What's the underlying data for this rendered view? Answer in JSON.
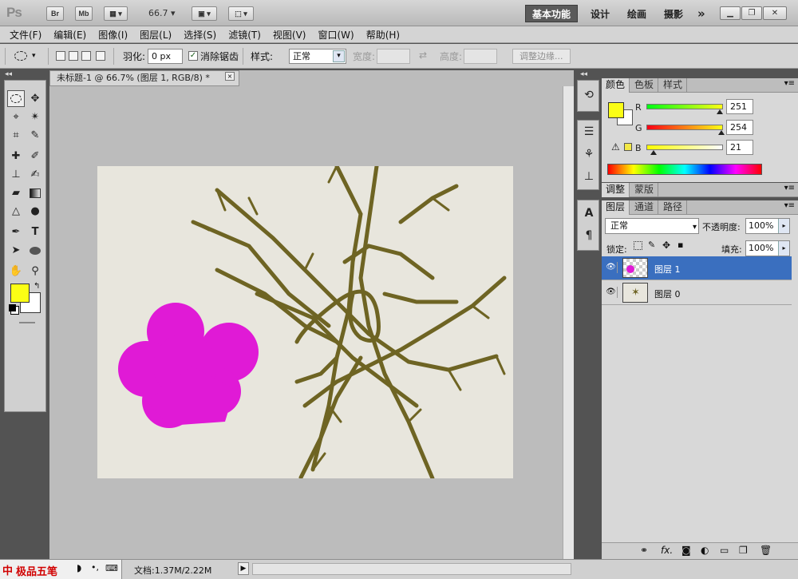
{
  "app": {
    "logo": "Ps",
    "bridge_label": "Br",
    "minibridge_label": "Mb",
    "zoom": "66.7",
    "workspaces": [
      "基本功能",
      "设计",
      "绘画",
      "摄影"
    ],
    "more": "»"
  },
  "menu": [
    "文件(F)",
    "编辑(E)",
    "图像(I)",
    "图层(L)",
    "选择(S)",
    "滤镜(T)",
    "视图(V)",
    "窗口(W)",
    "帮助(H)"
  ],
  "options": {
    "feather_label": "羽化:",
    "feather_value": "0 px",
    "antialias_label": "消除锯齿",
    "style_label": "样式:",
    "style_value": "正常",
    "width_label": "宽度:",
    "height_label": "高度:",
    "refine_label": "调整边缘..."
  },
  "document": {
    "tab_title": "未标题-1 @ 66.7% (图层 1, RGB/8) *",
    "close": "×"
  },
  "colors": {
    "foreground": "#fbfe15",
    "background": "#ffffff",
    "canvas": "#e8e6dd",
    "flower": "#e01ad6",
    "branch": "#6e6423"
  },
  "color_panel": {
    "tabs": [
      "颜色",
      "色板",
      "样式"
    ],
    "r_label": "R",
    "r_value": "251",
    "g_label": "G",
    "g_value": "254",
    "b_label": "B",
    "b_value": "21"
  },
  "adjust_panel": {
    "tabs": [
      "调整",
      "蒙版"
    ]
  },
  "layers_panel": {
    "tabs": [
      "图层",
      "通道",
      "路径"
    ],
    "blend_mode": "正常",
    "opacity_label": "不透明度:",
    "opacity_value": "100%",
    "lock_label": "锁定:",
    "fill_label": "填充:",
    "fill_value": "100%",
    "layers": [
      {
        "name": "图层 1",
        "selected": true
      },
      {
        "name": "图层 0",
        "selected": false
      }
    ]
  },
  "status": {
    "ime_label": "极品五笔",
    "doc_info": "文档:1.37M/2.22M"
  }
}
